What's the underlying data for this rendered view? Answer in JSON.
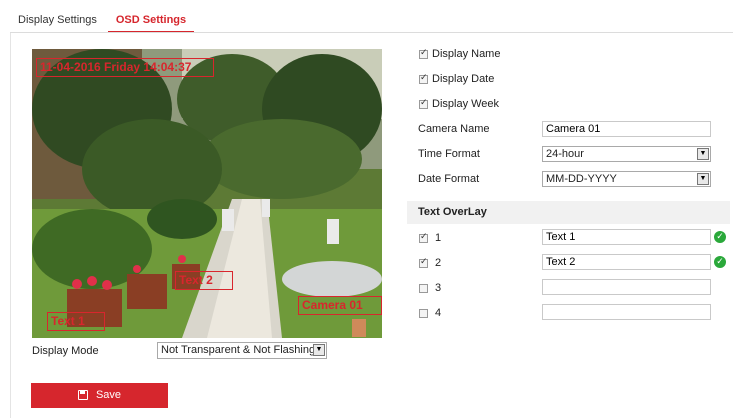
{
  "tabs": [
    {
      "label": "Display Settings",
      "active": false
    },
    {
      "label": "OSD Settings",
      "active": true
    }
  ],
  "preview": {
    "osd_date": "11-04-2016 Friday 14:04:37",
    "osd_text2": "Text 2",
    "osd_text1": "Text 1",
    "osd_camera": "Camera 01"
  },
  "display_mode": {
    "label": "Display Mode",
    "value": "Not Transparent & Not Flashing"
  },
  "save_label": "Save",
  "options": [
    {
      "label": "Display Name",
      "checked": true
    },
    {
      "label": "Display Date",
      "checked": true
    },
    {
      "label": "Display Week",
      "checked": true
    }
  ],
  "camera_name": {
    "label": "Camera Name",
    "value": "Camera 01"
  },
  "time_format": {
    "label": "Time Format",
    "value": "24-hour"
  },
  "date_format": {
    "label": "Date Format",
    "value": "MM-DD-YYYY"
  },
  "text_overlay": {
    "title": "Text OverLay",
    "rows": [
      {
        "num": "1",
        "checked": true,
        "value": "Text 1",
        "ok": true
      },
      {
        "num": "2",
        "checked": true,
        "value": "Text 2",
        "ok": true
      },
      {
        "num": "3",
        "checked": false,
        "value": "",
        "ok": false
      },
      {
        "num": "4",
        "checked": false,
        "value": "",
        "ok": false
      }
    ]
  },
  "colors": {
    "accent": "#d6262d",
    "ok": "#2aa83a"
  }
}
